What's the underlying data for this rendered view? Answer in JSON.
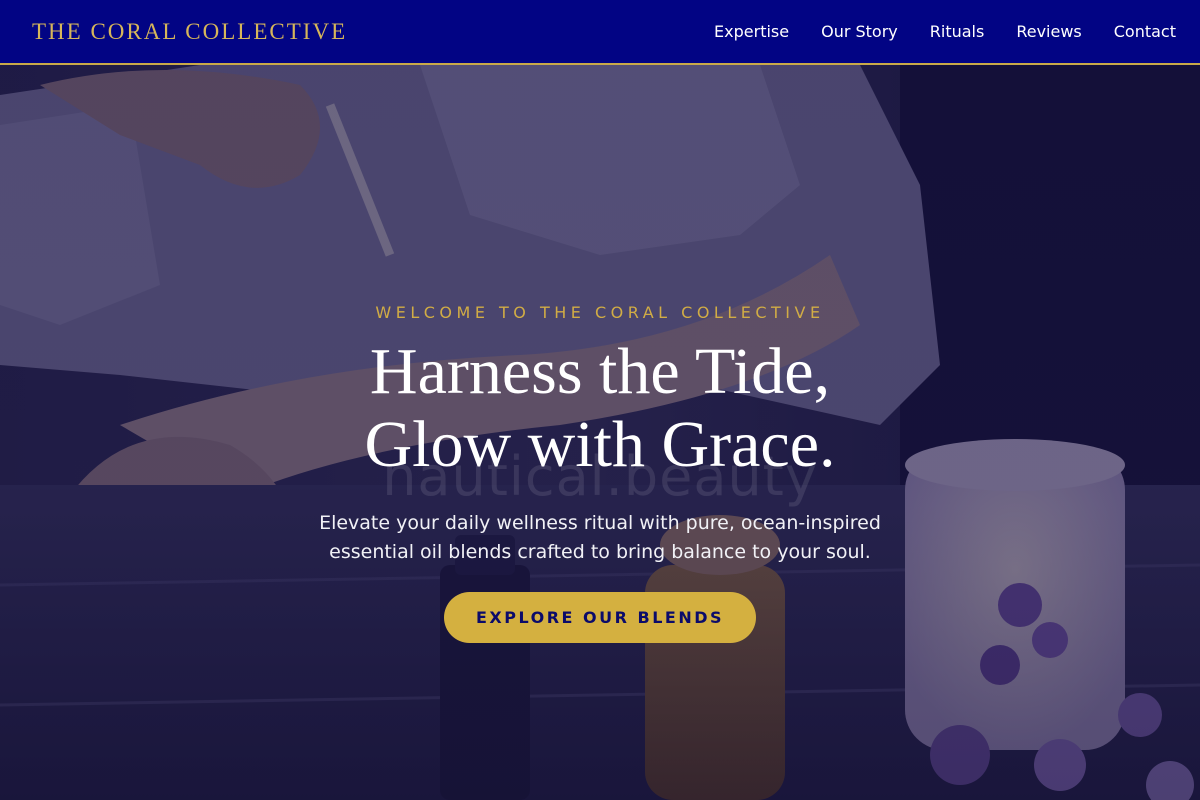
{
  "header": {
    "brand": "THE CORAL COLLECTIVE",
    "nav": [
      "Expertise",
      "Our Story",
      "Rituals",
      "Reviews",
      "Contact"
    ]
  },
  "hero": {
    "eyebrow": "WELCOME TO THE CORAL COLLECTIVE",
    "headline_line1": "Harness the Tide,",
    "headline_line2": "Glow with Grace.",
    "watermark": "nautical.beauty",
    "subtitle_line1": "Elevate your daily wellness ritual with pure, ocean-inspired",
    "subtitle_line2": "essential oil blends crafted to bring balance to your soul.",
    "cta_label": "EXPLORE OUR BLENDS"
  },
  "colors": {
    "nav_bg": "#020484",
    "gold": "#d4b040",
    "brand_text": "#d6b65a",
    "cta_text": "#0b0b6a"
  }
}
